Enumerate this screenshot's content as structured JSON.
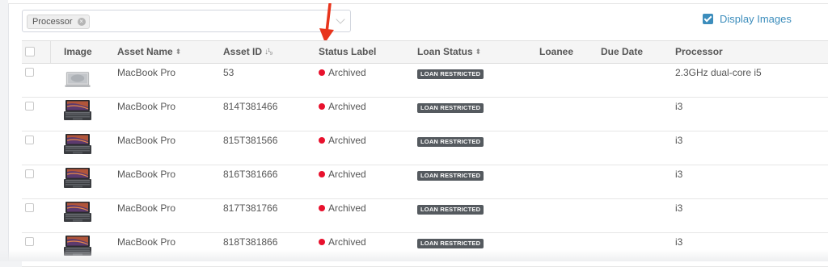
{
  "filter": {
    "chip_label": "Processor",
    "chip_remove": "×"
  },
  "display_images": {
    "label": "Display Images",
    "checked": true
  },
  "table": {
    "headers": {
      "image": "Image",
      "asset_name": "Asset Name",
      "asset_id": "Asset ID",
      "status_label": "Status Label",
      "loan_status": "Loan Status",
      "loanee": "Loanee",
      "due_date": "Due Date",
      "processor": "Processor"
    },
    "sort_icons": {
      "asset_name": "⬍",
      "asset_id": "↓",
      "loan_status": "⬍"
    },
    "rows": [
      {
        "asset_name": "MacBook Pro",
        "asset_id": "53",
        "status": "Archived",
        "loan_status": "LOAN RESTRICTED",
        "loanee": "",
        "due_date": "",
        "processor": "2.3GHz dual-core i5",
        "image": "macbook-closed"
      },
      {
        "asset_name": "MacBook Pro",
        "asset_id": "814T381466",
        "status": "Archived",
        "loan_status": "LOAN RESTRICTED",
        "loanee": "",
        "due_date": "",
        "processor": "i3",
        "image": "macbook-open"
      },
      {
        "asset_name": "MacBook Pro",
        "asset_id": "815T381566",
        "status": "Archived",
        "loan_status": "LOAN RESTRICTED",
        "loanee": "",
        "due_date": "",
        "processor": "i3",
        "image": "macbook-open"
      },
      {
        "asset_name": "MacBook Pro",
        "asset_id": "816T381666",
        "status": "Archived",
        "loan_status": "LOAN RESTRICTED",
        "loanee": "",
        "due_date": "",
        "processor": "i3",
        "image": "macbook-open"
      },
      {
        "asset_name": "MacBook Pro",
        "asset_id": "817T381766",
        "status": "Archived",
        "loan_status": "LOAN RESTRICTED",
        "loanee": "",
        "due_date": "",
        "processor": "i3",
        "image": "macbook-open"
      },
      {
        "asset_name": "MacBook Pro",
        "asset_id": "818T381866",
        "status": "Archived",
        "loan_status": "LOAN RESTRICTED",
        "loanee": "",
        "due_date": "",
        "processor": "i3",
        "image": "macbook-open"
      }
    ]
  },
  "colors": {
    "accent": "#3c8dbc",
    "status_archived": "#e8112d",
    "badge_bg": "#555a5f",
    "annotation_arrow": "#e8341c"
  },
  "icons": {
    "annotation": "red-arrow-icon",
    "sort": "sort-icon",
    "checkbox": "checkbox-icon"
  }
}
